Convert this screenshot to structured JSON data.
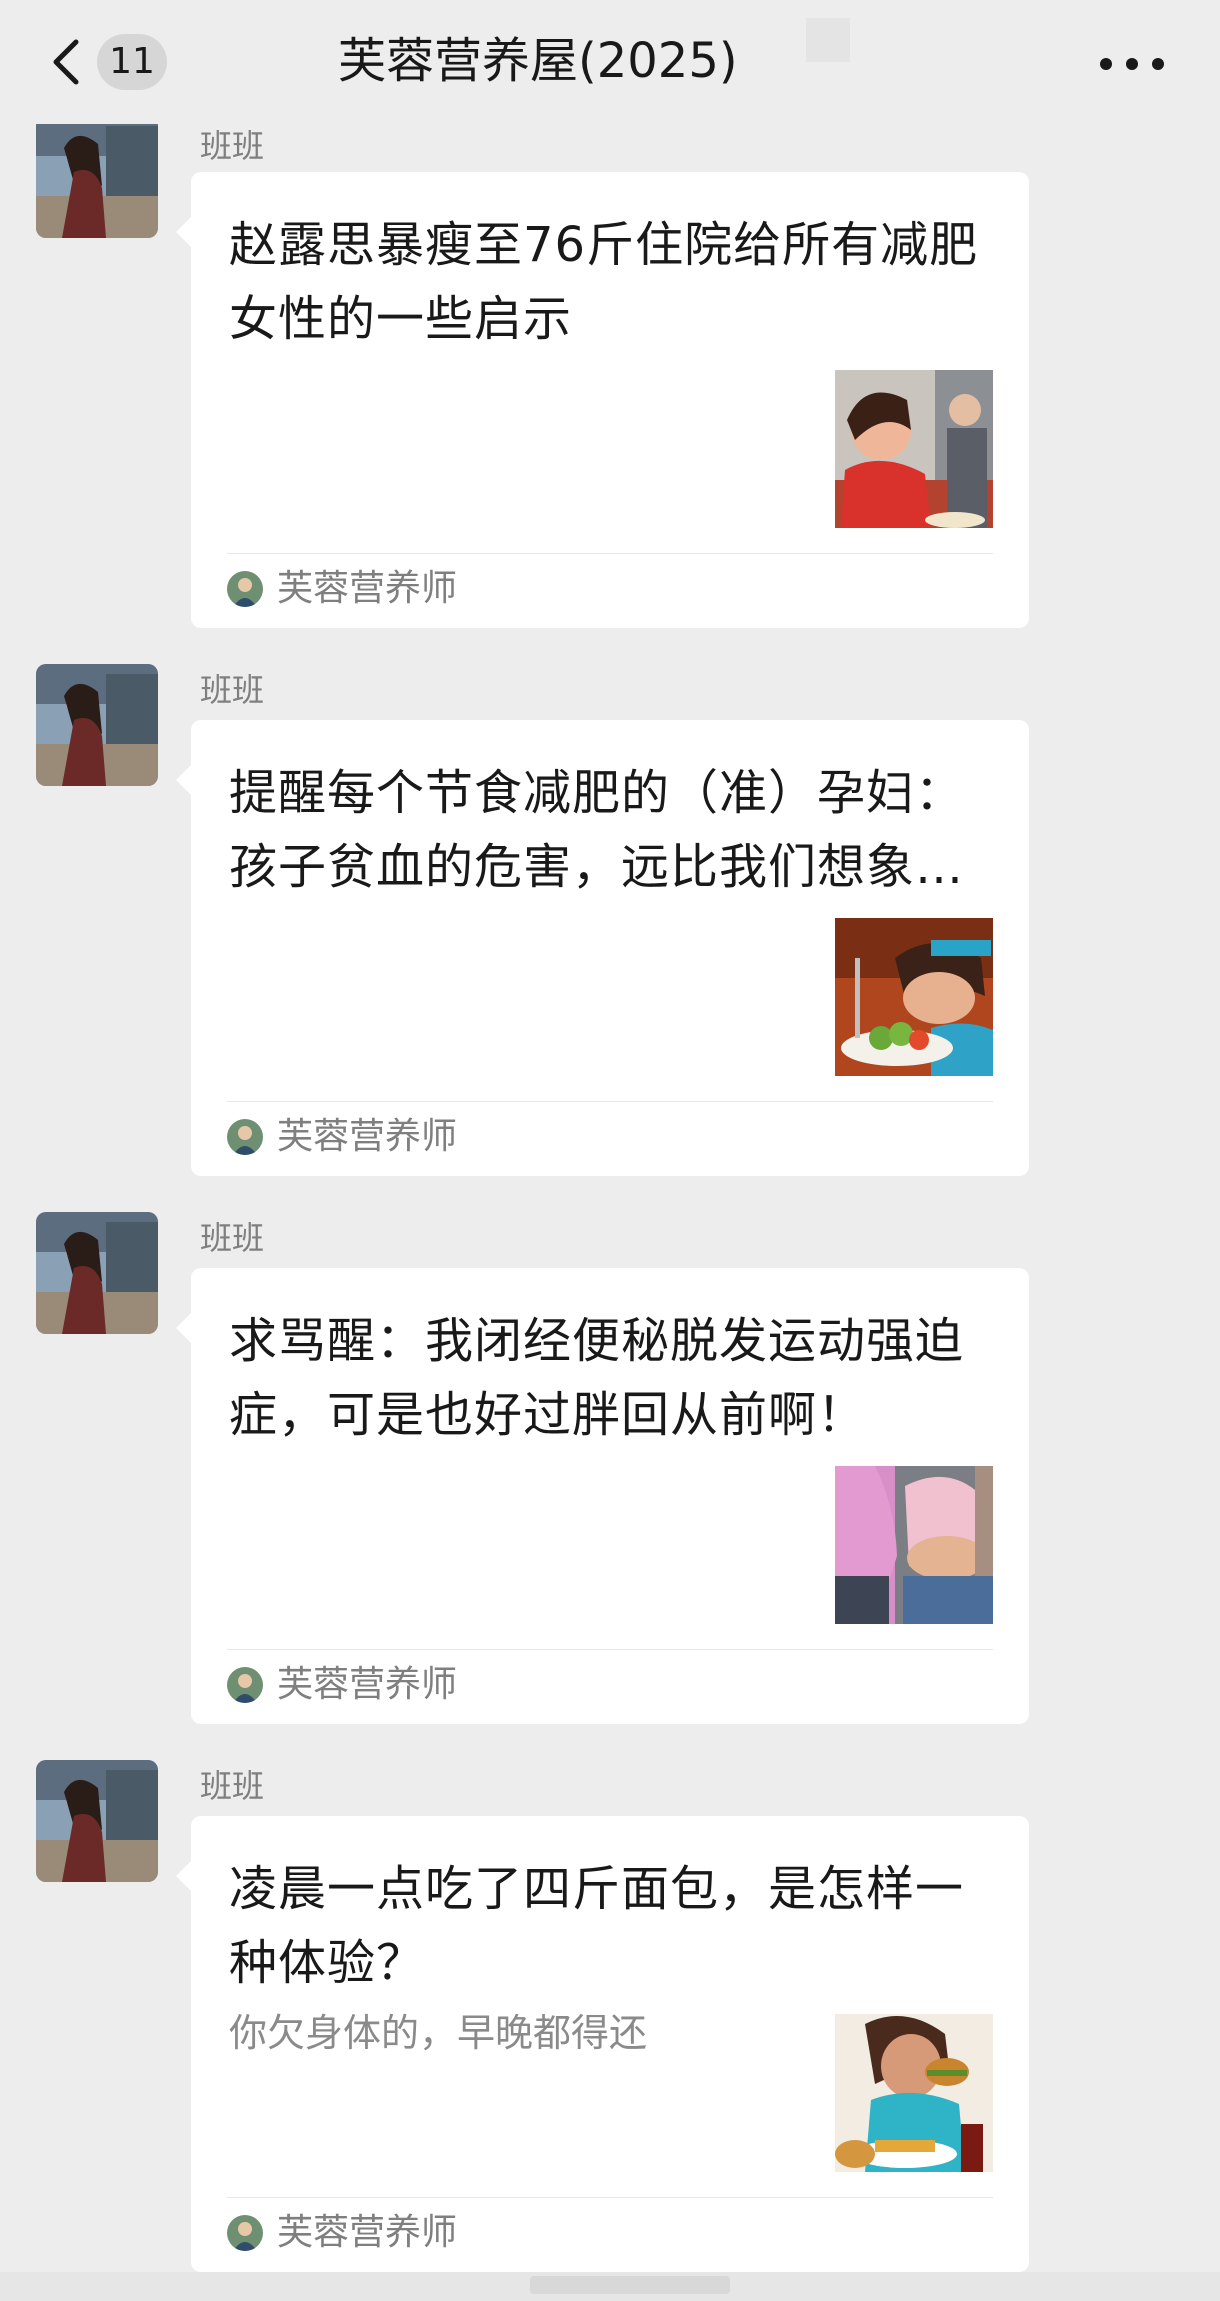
{
  "header": {
    "back_count": "11",
    "title": "芙蓉营养屋(2025)"
  },
  "messages": [
    {
      "sender": "班班",
      "title": "赵露思暴瘦至76斤住院给所有减肥女性的一些启示",
      "desc": "",
      "source": "芙蓉营养师",
      "thumb_icon": "girl-eating-photo"
    },
    {
      "sender": "班班",
      "title": "提醒每个节食减肥的（准）孕妇：孩子贫血的危害，远比我们想象…",
      "desc": "",
      "source": "芙蓉营养师",
      "thumb_icon": "tired-girl-salad-photo"
    },
    {
      "sender": "班班",
      "title": "求骂醒：我闭经便秘脱发运动强迫症，可是也好过胖回从前啊！",
      "desc": "",
      "source": "芙蓉营养师",
      "thumb_icon": "bellies-photo"
    },
    {
      "sender": "班班",
      "title": "凌晨一点吃了四斤面包，是怎样一种体验？",
      "desc": "你欠身体的，早晚都得还",
      "source": "芙蓉营养师",
      "thumb_icon": "girl-eating-burger-photo"
    }
  ],
  "colors": {
    "background": "#ededed",
    "card": "#ffffff",
    "text": "#191919",
    "secondary_text": "#7f7f7f"
  }
}
